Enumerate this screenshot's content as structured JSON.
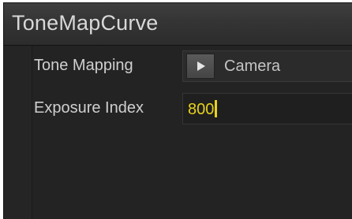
{
  "window": {
    "title": "ToneMapCurve"
  },
  "params": {
    "tone_mapping": {
      "label": "Tone Mapping",
      "value": "Camera",
      "icon": "triangle-right-icon"
    },
    "exposure_index": {
      "label": "Exposure Index",
      "value": "800"
    }
  },
  "colors": {
    "background": "#1e1e1e",
    "titlebar": "#363636",
    "label_text": "#cfcfcf",
    "input_value_text": "#e8d21a"
  }
}
